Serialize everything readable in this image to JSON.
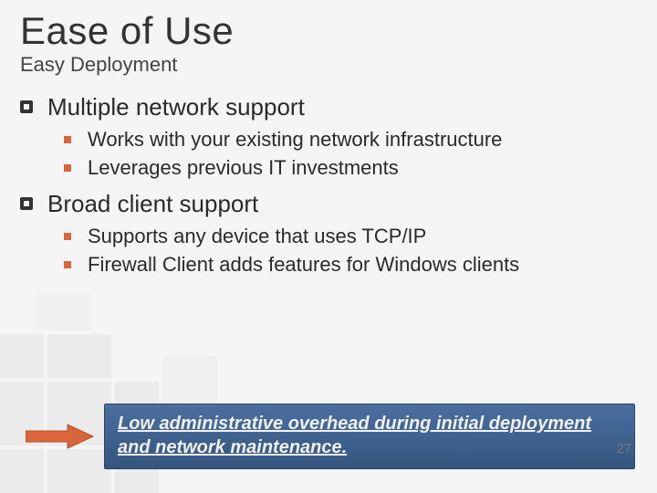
{
  "title": "Ease of Use",
  "subtitle": "Easy Deployment",
  "bullets": [
    {
      "text": "Multiple network support",
      "children": [
        "Works with your existing network infrastructure",
        "Leverages previous IT investments"
      ]
    },
    {
      "text": "Broad client support",
      "children": [
        "Supports any device that uses TCP/IP",
        "Firewall Client adds features for Windows clients"
      ]
    }
  ],
  "callout": "Low administrative overhead during initial deployment and network maintenance.",
  "slide_number": "27",
  "colors": {
    "accent_square": "#d9663b",
    "arrow": "#d9663b",
    "callout_bg_top": "#4a6fa0",
    "callout_bg_bottom": "#35557e"
  }
}
